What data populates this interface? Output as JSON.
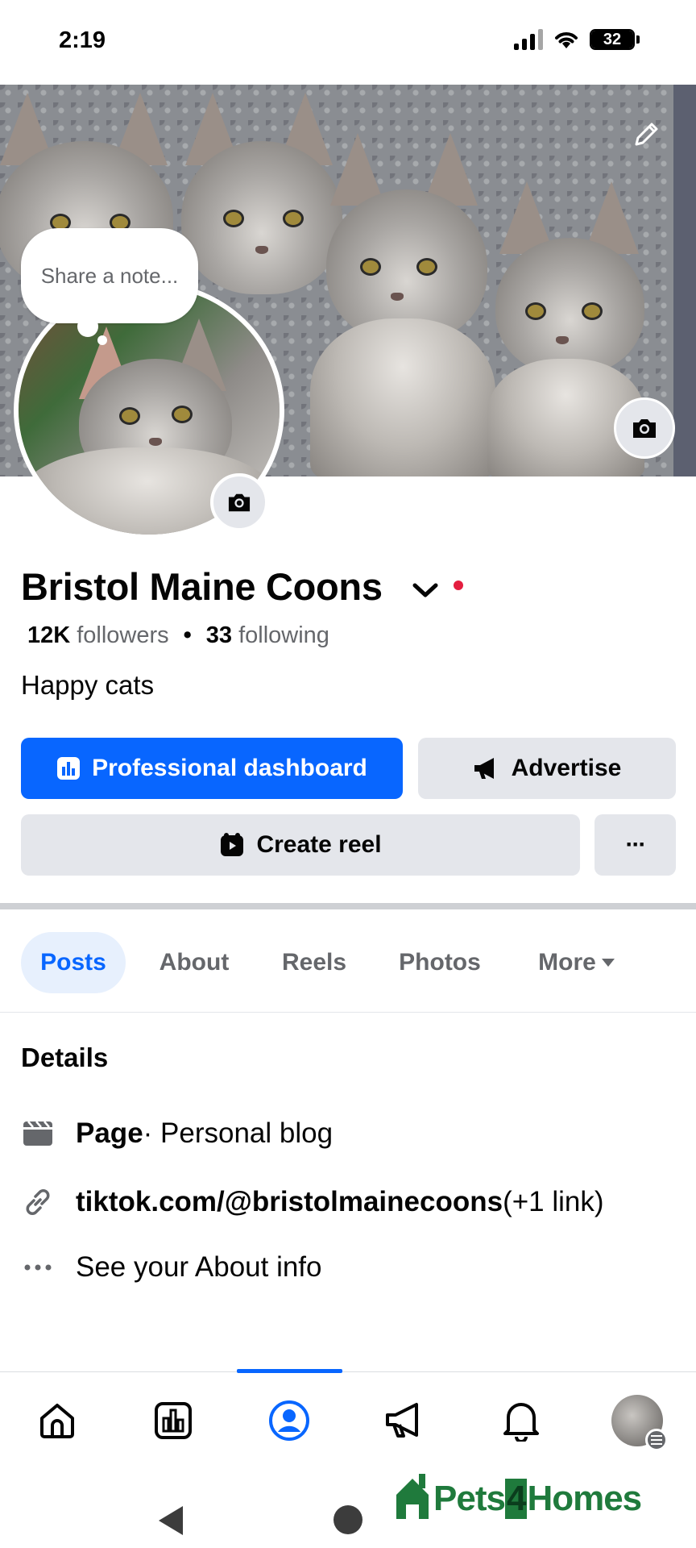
{
  "status_bar": {
    "time": "2:19",
    "battery": "32",
    "battery_level": 0.32
  },
  "cover": {
    "edit_icon": "pencil-icon",
    "camera_icon": "camera-icon"
  },
  "note": {
    "placeholder": "Share a note..."
  },
  "profile": {
    "name": "Bristol Maine Coons",
    "followers_count": "12K",
    "followers_label": "followers",
    "separator": "•",
    "following_count": "33",
    "following_label": "following",
    "bio": "Happy cats"
  },
  "actions": {
    "professional_dashboard": "Professional dashboard",
    "advertise": "Advertise",
    "create_reel": "Create reel",
    "more": "···"
  },
  "tabs": [
    {
      "label": "Posts",
      "active": true
    },
    {
      "label": "About",
      "active": false
    },
    {
      "label": "Reels",
      "active": false
    },
    {
      "label": "Photos",
      "active": false
    },
    {
      "label": "More",
      "active": false
    }
  ],
  "details": {
    "title": "Details",
    "page_label": "Page",
    "page_category": " · Personal blog",
    "link_text": "tiktok.com/@bristolmainecoons",
    "link_extra": " (+1 link)",
    "about_info": "See your About info"
  },
  "bottom_nav": {
    "items": [
      "home-icon",
      "dashboard-icon",
      "profile-icon",
      "megaphone-icon",
      "bell-icon",
      "menu-avatar"
    ],
    "active_index": 2
  },
  "watermark": {
    "text_part1": "Pets",
    "text_part2": "4",
    "text_part3": "Homes"
  },
  "colors": {
    "accent": "#0866ff",
    "button_gray": "#e4e6eb",
    "text_primary": "#050505",
    "text_secondary": "#65676b",
    "notification_red": "#e41e3f"
  }
}
